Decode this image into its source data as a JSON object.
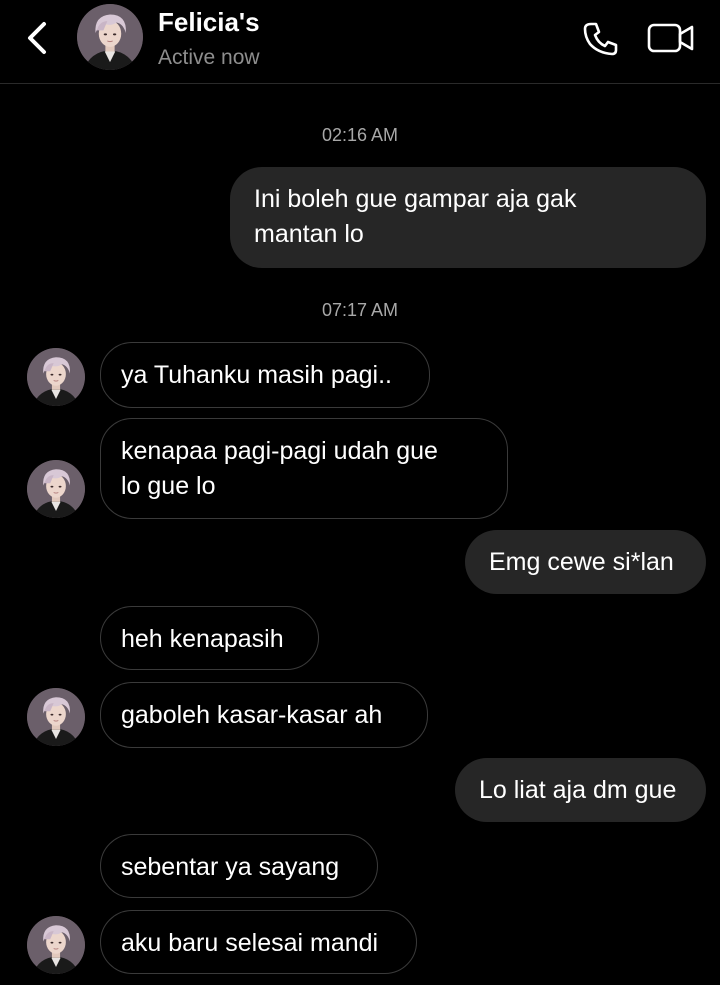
{
  "header": {
    "name": "Felicia's",
    "status": "Active now",
    "icons": {
      "back": "chevron-left-icon",
      "call": "phone-icon",
      "video": "video-camera-icon"
    }
  },
  "messages": {
    "t1": "02:16 AM",
    "m1": "Ini boleh gue gampar aja gak",
    "m1b": "mantan lo",
    "t2": "07:17 AM",
    "m2": "ya Tuhanku masih pagi..",
    "m3": "kenapaa pagi-pagi udah gue",
    "m3b": "lo gue lo",
    "m4": "Emg cewe si*lan",
    "m5": "heh kenapasih",
    "m6": "gaboleh kasar-kasar ah",
    "m7": "Lo liat aja dm gue",
    "m8": "sebentar ya sayang",
    "m9": "aku baru selesai mandi"
  },
  "colors": {
    "background": "#000000",
    "outgoing_bubble": "#262626",
    "incoming_border": "#3a3a3a",
    "secondary_text": "#8e8e8e"
  }
}
